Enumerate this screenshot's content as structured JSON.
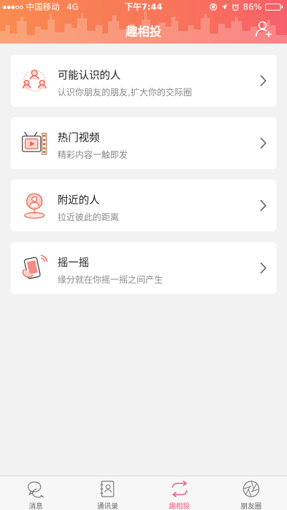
{
  "status_bar": {
    "carrier": "中国移动",
    "network": "4G",
    "time": "下午7:44",
    "battery": "86%",
    "battery_level": 0.86
  },
  "header": {
    "title": "趣相投",
    "add_friend_icon": "add-user-icon"
  },
  "cards": [
    {
      "title": "可能认识的人",
      "subtitle": "认识你朋友的朋友,扩大你的交际圈",
      "icon": "people-network-icon"
    },
    {
      "title": "热门视频",
      "subtitle": "精彩内容一触即发",
      "icon": "video-film-icon"
    },
    {
      "title": "附近的人",
      "subtitle": "拉近彼此的距离",
      "icon": "nearby-person-icon"
    },
    {
      "title": "摇一摇",
      "subtitle": "缘分就在你摇一摇之间产生",
      "icon": "shake-phone-icon"
    }
  ],
  "tabbar": {
    "items": [
      {
        "label": "消息",
        "icon": "chat-bubble-icon",
        "active": false
      },
      {
        "label": "通讯录",
        "icon": "contacts-book-icon",
        "active": false
      },
      {
        "label": "趣相投",
        "icon": "exchange-arrows-icon",
        "active": true
      },
      {
        "label": "朋友圈",
        "icon": "camera-aperture-icon",
        "active": false
      }
    ]
  },
  "colors": {
    "header_start": "#f98b50",
    "header_end": "#f7606a",
    "accent": "#f0607a",
    "icon_accent": "#e95c4b"
  }
}
